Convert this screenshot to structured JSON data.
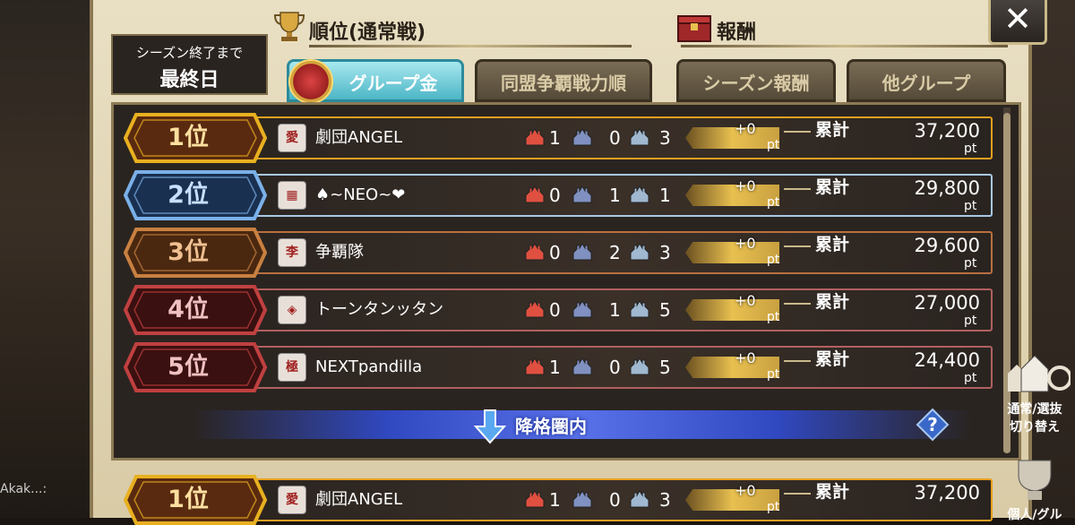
{
  "background": {
    "bottom_left_text": "Akak...:"
  },
  "season": {
    "line1": "シーズン終了まで",
    "line2": "最終日"
  },
  "headers": {
    "ranking_title": "順位(通常戦)",
    "reward_title": "報酬"
  },
  "tabs": {
    "group": "グループ金",
    "alliance": "同盟争覇戦力順",
    "season_reward": "シーズン報酬",
    "other_group": "他グループ"
  },
  "rows": [
    {
      "rank": "1位",
      "flag": "愛",
      "name": "劇団ANGEL",
      "c1": "1",
      "c2": "0",
      "c3": "3",
      "pt": "+0",
      "pt_unit": "pt",
      "total_label": "累計",
      "total": "37,200",
      "total_unit": "pt"
    },
    {
      "rank": "2位",
      "flag": "▦",
      "name": "♠~NEO~❤",
      "c1": "0",
      "c2": "1",
      "c3": "1",
      "pt": "+0",
      "pt_unit": "pt",
      "total_label": "累計",
      "total": "29,800",
      "total_unit": "pt"
    },
    {
      "rank": "3位",
      "flag": "李",
      "name": "争覇隊",
      "c1": "0",
      "c2": "2",
      "c3": "3",
      "pt": "+0",
      "pt_unit": "pt",
      "total_label": "累計",
      "total": "29,600",
      "total_unit": "pt"
    },
    {
      "rank": "4位",
      "flag": "◈",
      "name": "トーンタンッタン",
      "c1": "0",
      "c2": "1",
      "c3": "5",
      "pt": "+0",
      "pt_unit": "pt",
      "total_label": "累計",
      "total": "27,000",
      "total_unit": "pt"
    },
    {
      "rank": "5位",
      "flag": "極",
      "name": "NEXTpandilla",
      "c1": "1",
      "c2": "0",
      "c3": "5",
      "pt": "+0",
      "pt_unit": "pt",
      "total_label": "累計",
      "total": "24,400",
      "total_unit": "pt"
    }
  ],
  "demotion": {
    "label": "降格圏内",
    "help": "?"
  },
  "pinned_row": {
    "rank": "1位",
    "flag": "愛",
    "name": "劇団ANGEL",
    "c1": "1",
    "c2": "0",
    "c3": "3",
    "pt": "+0",
    "pt_unit": "pt",
    "total_label": "累計",
    "total": "37,200"
  },
  "side": {
    "switch_line1": "通常/選抜",
    "switch_line2": "切り替え",
    "bottom_label": "個人/グル"
  },
  "colors": {
    "gold": "#e8b020",
    "silver_blue": "#7ab0e8",
    "bronze": "#c88040",
    "red_rank": "#c04040",
    "tab_active": "#4cb6c6"
  },
  "icons": {
    "close": "close-icon",
    "trophy": "trophy-icon",
    "reward": "treasure-box-icon",
    "castle": "castle-icon",
    "help": "help-icon",
    "down_arrow": "down-arrow-icon"
  }
}
